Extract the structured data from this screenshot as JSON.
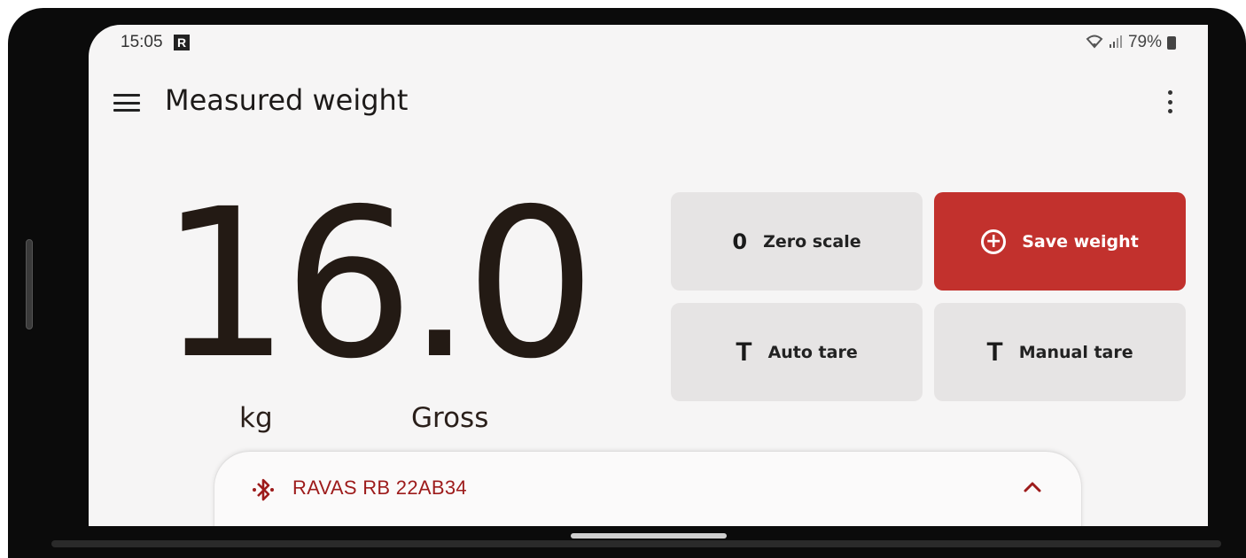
{
  "status_bar": {
    "time": "15:05",
    "notification_badge": "R",
    "battery": "79%",
    "icons": [
      "wifi-icon",
      "signal-icon",
      "battery-icon"
    ]
  },
  "app_bar": {
    "title": "Measured weight",
    "menu_icon": "menu-icon",
    "more_icon": "more-vert-icon"
  },
  "weight": {
    "value": "16.0",
    "unit": "kg",
    "mode": "Gross"
  },
  "actions": {
    "zero": {
      "glyph": "0",
      "label": "Zero scale"
    },
    "save": {
      "glyph": "+",
      "label": "Save weight",
      "icon": "add-circle-icon"
    },
    "auto_tare": {
      "glyph": "T",
      "label": "Auto tare"
    },
    "manual_tare": {
      "glyph": "T",
      "label": "Manual tare"
    }
  },
  "device": {
    "name": "RAVAS RB 22AB34",
    "icon": "bluetooth-connected-icon",
    "expand_icon": "chevron-up-icon"
  },
  "colors": {
    "accent": "#c2312d",
    "device_text": "#9d1b1b",
    "background": "#f6f5f5",
    "button_bg": "#e6e4e4"
  }
}
